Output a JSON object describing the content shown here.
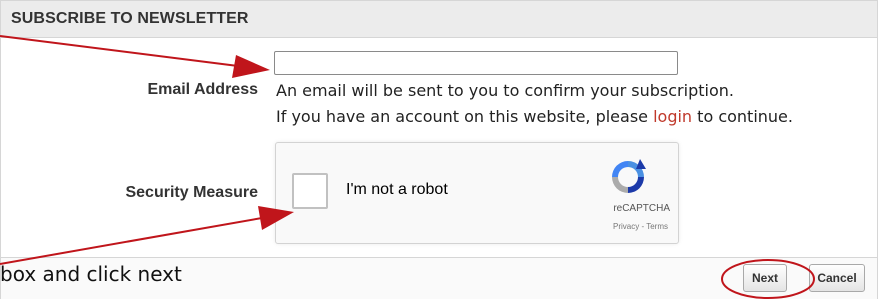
{
  "panel": {
    "title": "SUBSCRIBE TO NEWSLETTER"
  },
  "email": {
    "label": "Email Address",
    "value": "",
    "placeholder": "",
    "help_line_1": "An email will be sent to you to confirm your subscription.",
    "help_line_2_before": "If you have an account on this website, please ",
    "help_line_2_link": "login",
    "help_line_2_after": " to continue."
  },
  "security": {
    "label": "Security Measure",
    "checkbox_label": "I'm not a robot",
    "brand": "reCAPTCHA",
    "links": "Privacy - Terms"
  },
  "annotation": {
    "instruction": "box and click next",
    "arrow_color": "#c0151b"
  },
  "buttons": {
    "next": "Next",
    "cancel": "Cancel"
  }
}
